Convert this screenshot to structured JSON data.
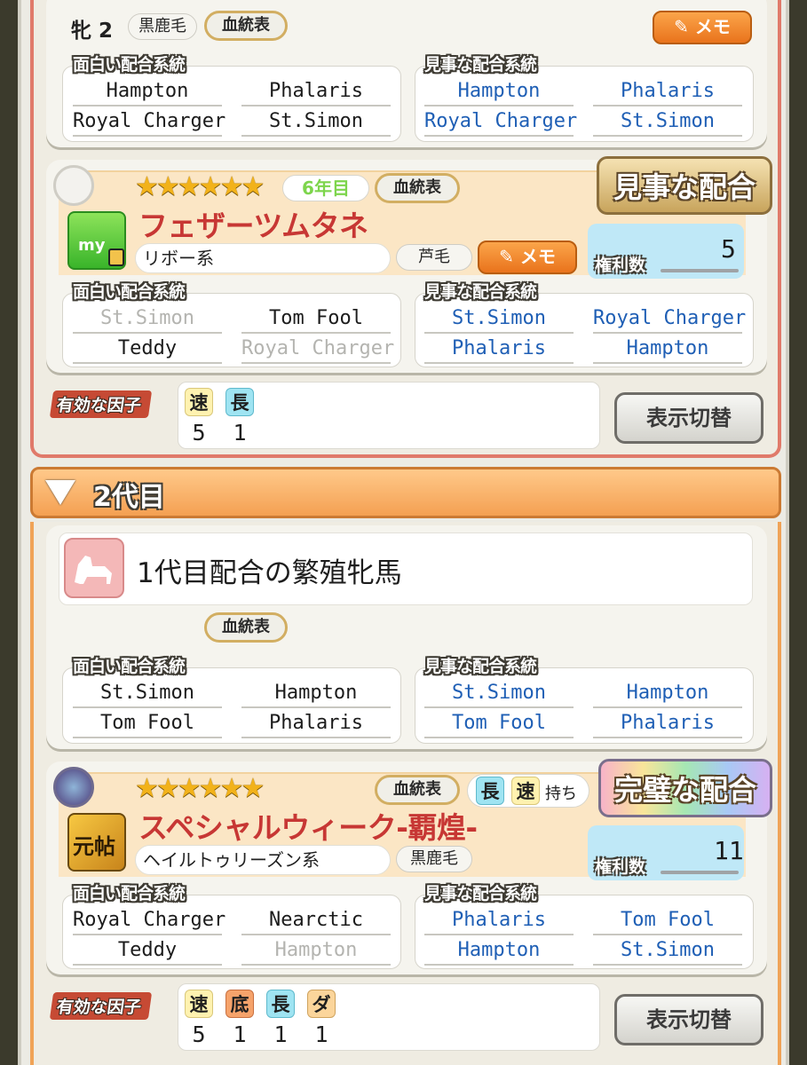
{
  "top_card": {
    "horse_summary": {
      "label": "牝 2",
      "coat": "黒鹿毛",
      "pedigree": "血統表",
      "memo": "メモ"
    },
    "fun_lines": {
      "title": "面白い配合系統",
      "cells": [
        "Hampton",
        "Phalaris",
        "Royal Charger",
        "St.Simon"
      ]
    },
    "great_lines": {
      "title": "見事な配合系統",
      "cells": [
        "Hampton",
        "Phalaris",
        "Royal Charger",
        "St.Simon"
      ]
    },
    "stallion": {
      "stars": "★★★★★★",
      "year": "6年目",
      "pedigree": "血統表",
      "badge": "見事な配合",
      "icon_text": "my",
      "name": "フェザーツムタネ",
      "line": "リボー系",
      "coat": "芦毛",
      "memo": "メモ",
      "rights_label": "権利数",
      "rights_value": "5"
    },
    "fun_lines2": {
      "title": "面白い配合系統",
      "cells": [
        "St.Simon",
        "Tom Fool",
        "Teddy",
        "Royal Charger"
      ]
    },
    "great_lines2": {
      "title": "見事な配合系統",
      "cells": [
        "St.Simon",
        "Royal Charger",
        "Phalaris",
        "Hampton"
      ]
    },
    "factors": {
      "label": "有効な因子",
      "chips": [
        "速",
        "長"
      ],
      "values": [
        "5",
        "1"
      ],
      "toggle": "表示切替"
    }
  },
  "section": {
    "title": "2代目"
  },
  "second_card": {
    "mare_title": "1代目配合の繁殖牝馬",
    "pedigree": "血統表",
    "fun_lines": {
      "title": "面白い配合系統",
      "cells": [
        "St.Simon",
        "Hampton",
        "Tom Fool",
        "Phalaris"
      ]
    },
    "great_lines": {
      "title": "見事な配合系統",
      "cells": [
        "St.Simon",
        "Hampton",
        "Tom Fool",
        "Phalaris"
      ]
    },
    "stallion": {
      "stars": "★★★★★★",
      "pedigree": "血統表",
      "factor_chips": [
        "長",
        "速"
      ],
      "holds": "持ち",
      "badge": "完璧な配合",
      "icon_text": "元帖",
      "name": "スペシャルウィーク-覇煌-",
      "line": "ヘイルトゥリーズン系",
      "coat": "黒鹿毛",
      "rights_label": "権利数",
      "rights_value": "11"
    },
    "fun_lines2": {
      "title": "面白い配合系統",
      "cells": [
        "Royal Charger",
        "Nearctic",
        "Teddy",
        "Hampton"
      ]
    },
    "great_lines2": {
      "title": "見事な配合系統",
      "cells": [
        "Phalaris",
        "Tom Fool",
        "Hampton",
        "St.Simon"
      ]
    },
    "factors": {
      "label": "有効な因子",
      "chips": [
        "速",
        "底",
        "長",
        "ダ"
      ],
      "values": [
        "5",
        "1",
        "1",
        "1"
      ],
      "toggle": "表示切替"
    }
  },
  "colors": {
    "speed": "#fff2b0",
    "stamina": "#9fe4f2",
    "base": "#f6a36b",
    "dirt": "#fbd59b",
    "accent": "#c73734"
  }
}
